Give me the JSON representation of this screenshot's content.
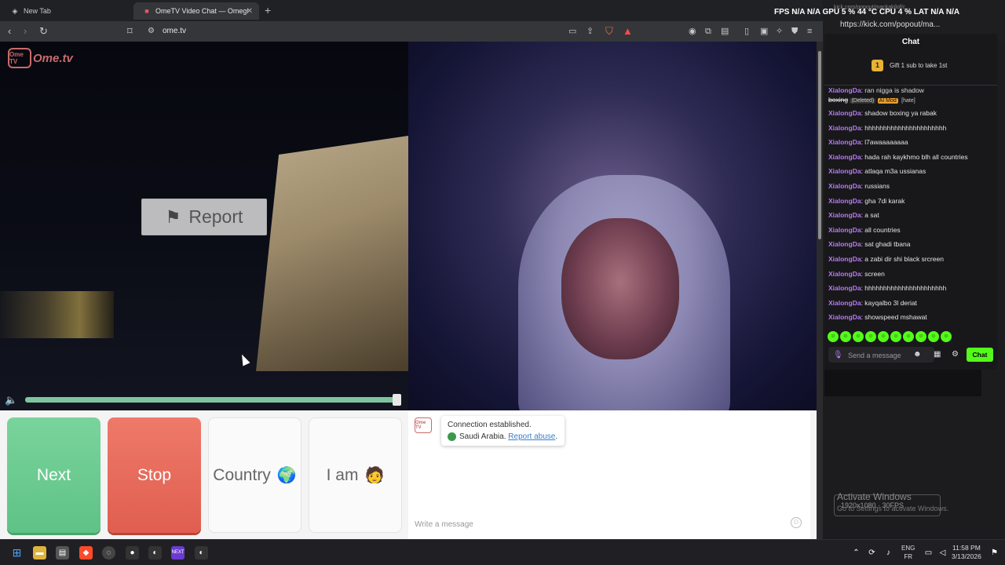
{
  "browser": {
    "tabs": [
      {
        "label": "New Tab",
        "active": false
      },
      {
        "label": "OmeTV Video Chat — Omegl",
        "active": true
      }
    ],
    "address": "ome.tv"
  },
  "ometv": {
    "logo_small": "Ome TV",
    "logo_text": "Ome.tv",
    "report_label": "Report",
    "buttons": {
      "next": "Next",
      "stop": "Stop",
      "country": "Country",
      "country_emoji": "🌍",
      "iam": "I am",
      "iam_emoji": "🧑"
    },
    "status": {
      "line1": "Connection established.",
      "country": "Saudi Arabia.",
      "report_abuse": "Report abuse",
      "period": "."
    },
    "message_placeholder": "Write a message",
    "volume_level": 0.99
  },
  "kick": {
    "url_small": "kick.com/popout/mackakilof/c...",
    "url": "https://kick.com/popout/ma...",
    "chat_title": "Chat",
    "gift_text": "Gift 1 sub to take 1st",
    "gift_count": "1",
    "send_label": "Chat",
    "input_placeholder": "Send a message",
    "first_message": {
      "text": "ran nigga is shadow",
      "line2": "boxing",
      "badge1": "(Deleted)",
      "badge2": "AI Mod",
      "badge3": "[hate]"
    },
    "messages": [
      {
        "user": "XialongDa",
        "text": "shadow boxing ya rabak"
      },
      {
        "user": "XialongDa",
        "text": "hhhhhhhhhhhhhhhhhhhhhh"
      },
      {
        "user": "XialongDa",
        "text": "l7awaaaaaaaa"
      },
      {
        "user": "XialongDa",
        "text": "hada rah kaykhmo blh all countries"
      },
      {
        "user": "XialongDa",
        "text": "atlaqa m3a ussianas"
      },
      {
        "user": "XialongDa",
        "text": "russians"
      },
      {
        "user": "XialongDa",
        "text": "gha 7di karak"
      },
      {
        "user": "XialongDa",
        "text": "a sat"
      },
      {
        "user": "XialongDa",
        "text": "all countries"
      },
      {
        "user": "XialongDa",
        "text": "sat ghadi tbana"
      },
      {
        "user": "XialongDa",
        "text": "a zabi dir shi black srcreen"
      },
      {
        "user": "XialongDa",
        "text": "screen"
      },
      {
        "user": "XialongDa",
        "text": "hhhhhhhhhhhhhhhhhhhhhh"
      },
      {
        "user": "XialongDa",
        "text": "kayqalbo 3l deriat"
      },
      {
        "user": "XialongDa",
        "text": "showspeed mshawat"
      }
    ]
  },
  "overlay": {
    "stats": "FPS N/A  N/A   GPU  5 %  44 °C   CPU  4 %    LAT  N/A  N/A"
  },
  "watermark": {
    "title": "Activate Windows",
    "sub": "Go to Settings to activate Windows.",
    "res": "1920x1080 · 30FPS"
  },
  "taskbar": {
    "lang_line1": "ENG",
    "lang_line2": "FR",
    "time": "11:58 PM",
    "date": "3/13/2026"
  },
  "colors": {
    "next": "#6acb91",
    "stop": "#e7685a",
    "kick_green": "#53fc18",
    "kick_user": "#b77bf0"
  }
}
